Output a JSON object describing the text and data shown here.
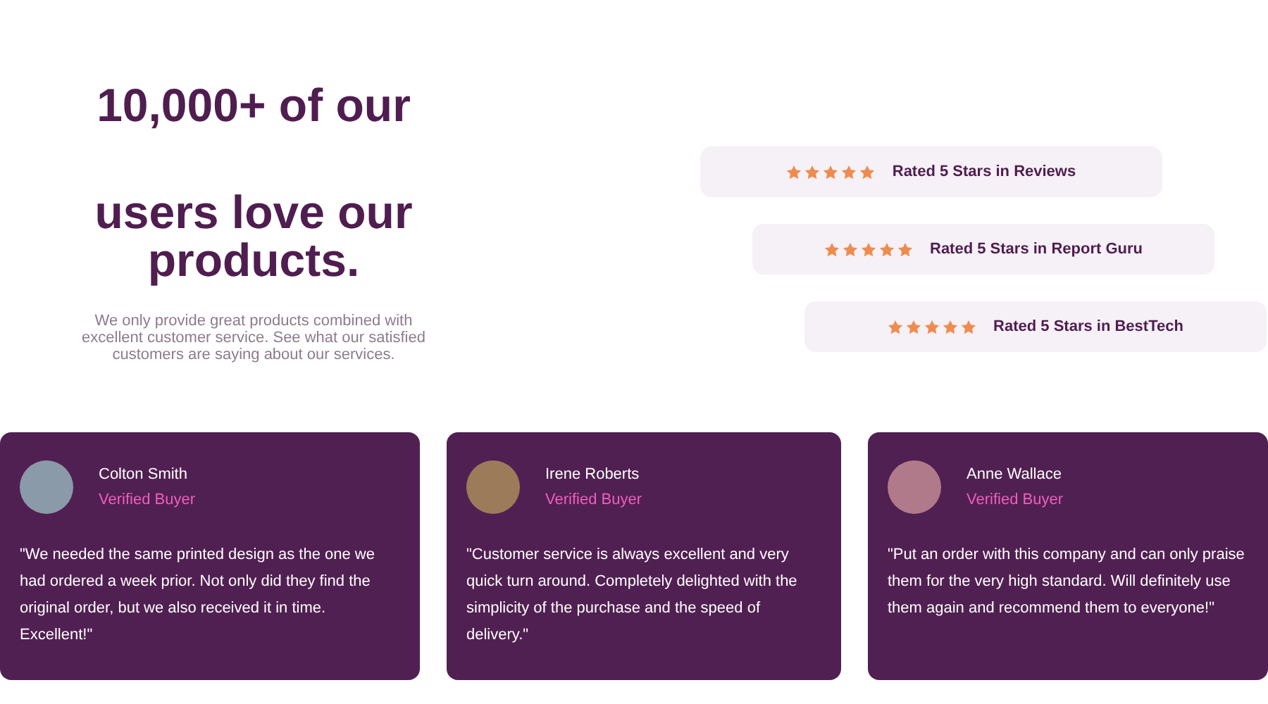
{
  "heading": {
    "lines": [
      "10,000+ of our",
      "users love our products."
    ]
  },
  "intro": "We only provide great products combined with excellent customer service. See what our satisfied customers are saying about our services.",
  "ratings": [
    {
      "stars": 5,
      "label": "Rated 5 Stars in Reviews"
    },
    {
      "stars": 5,
      "label": "Rated 5 Stars in Report Guru"
    },
    {
      "stars": 5,
      "label": "Rated 5 Stars in BestTech"
    }
  ],
  "testimonials": [
    {
      "name": "Colton Smith",
      "badge": "Verified Buyer",
      "quote": "\"We needed the same printed design as the one we had ordered a week prior. Not only did they find the original order, but we also received it in time. Excellent!\""
    },
    {
      "name": "Irene Roberts",
      "badge": "Verified Buyer",
      "quote": "\"Customer service is always excellent and very quick turn around. Completely delighted with the simplicity of the purchase and the speed of delivery.\""
    },
    {
      "name": "Anne Wallace",
      "badge": "Verified Buyer",
      "quote": "\"Put an order with this company and can only praise them for the very high standard. Will definitely use them again and recommend them to everyone!\""
    }
  ]
}
